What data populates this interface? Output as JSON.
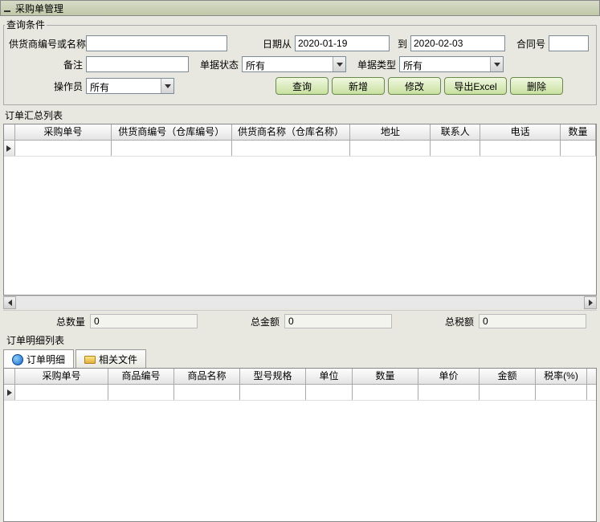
{
  "title": "采购单管理",
  "search": {
    "legend": "查询条件",
    "supplier_label": "供货商编号或名称",
    "supplier_value": "",
    "date_from_label": "日期从",
    "date_from": "2020-01-19",
    "date_to_label": "到",
    "date_to": "2020-02-03",
    "contract_label": "合同号",
    "contract_value": "",
    "remark_label": "备注",
    "remark_value": "",
    "bill_status_label": "单据状态",
    "bill_status_value": "所有",
    "bill_type_label": "单据类型",
    "bill_type_value": "所有",
    "operator_label": "操作员",
    "operator_value": "所有"
  },
  "buttons": {
    "query": "查询",
    "add": "新增",
    "edit": "修改",
    "export": "导出Excel",
    "delete": "删除"
  },
  "summary_list_label": "订单汇总列表",
  "grid1_cols": [
    "采购单号",
    "供货商编号（仓库编号）",
    "供货商名称（仓库名称）",
    "地址",
    "联系人",
    "电话",
    "数量"
  ],
  "totals": {
    "qty_label": "总数量",
    "qty_value": "0",
    "amt_label": "总金额",
    "amt_value": "0",
    "tax_label": "总税额",
    "tax_value": "0"
  },
  "detail_list_label": "订单明细列表",
  "tabs": {
    "detail": "订单明细",
    "files": "相关文件"
  },
  "grid2_cols": [
    "采购单号",
    "商品编号",
    "商品名称",
    "型号规格",
    "单位",
    "数量",
    "单价",
    "金额",
    "税率(%)"
  ]
}
